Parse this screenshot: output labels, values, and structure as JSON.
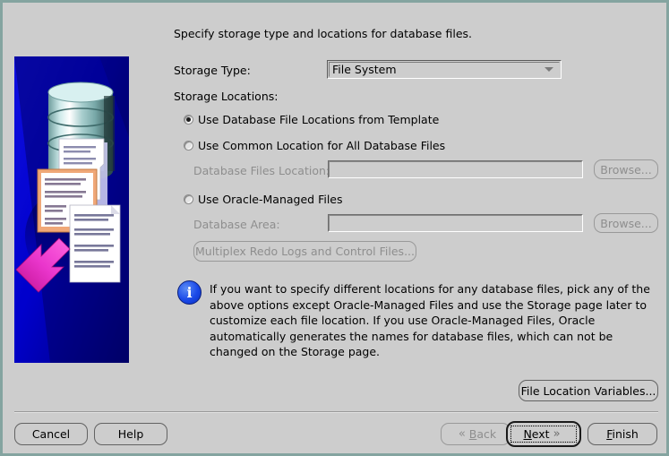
{
  "window": {
    "border_color": "#84a4a0",
    "background": "#cdcdcd"
  },
  "heading": "Specify storage type and locations for database files.",
  "form": {
    "storage_type_label": "Storage Type:",
    "storage_type_value": "File System",
    "storage_type_arrow_icon": "chevron-down-icon",
    "storage_locations_label": "Storage Locations:",
    "options": [
      {
        "label": "Use Database File Locations from Template",
        "selected": true
      },
      {
        "label": "Use Common Location for All Database Files",
        "selected": false
      },
      {
        "label": "Use Oracle-Managed Files",
        "selected": false
      }
    ],
    "db_files_location_label": "Database Files Location:",
    "db_files_location_value": "",
    "db_files_location_disabled": true,
    "database_area_label": "Database Area:",
    "database_area_value": "",
    "database_area_disabled": true,
    "browse_label_1": "Browse...",
    "browse_label_2": "Browse...",
    "multiplex_label": "Multiplex Redo Logs and Control Files..."
  },
  "info": {
    "icon": "info-icon",
    "icon_glyph": "i",
    "icon_color": "#1a49e8",
    "text": "If you want to specify different locations for any database files, pick any of the above options except Oracle-Managed Files and use the Storage page later to customize each file location. If you use Oracle-Managed Files, Oracle automatically generates the names for database files, which can not be changed on the Storage page."
  },
  "actions": {
    "file_location_variables_label": "File Location Variables...",
    "cancel_label": "Cancel",
    "help_label": "Help",
    "back_label": "Back",
    "back_mnemonic": "B",
    "back_chevron_icon": "chevron-double-left-icon",
    "back_chevron_glyph": "«",
    "next_label": "Next",
    "next_mnemonic": "N",
    "next_chevron_icon": "chevron-double-right-icon",
    "next_chevron_glyph": "»",
    "finish_label": "Finish",
    "finish_mnemonic": "F"
  },
  "illustration": {
    "name": "database-files-illustration",
    "background_color": "#0000d2",
    "arrow_color": "#e830c8",
    "cylinder_color": "#b8d8d8"
  }
}
